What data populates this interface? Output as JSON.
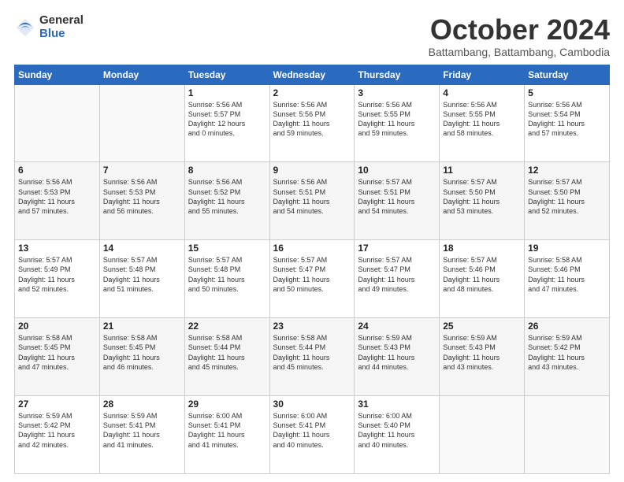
{
  "logo": {
    "general": "General",
    "blue": "Blue"
  },
  "header": {
    "month": "October 2024",
    "location": "Battambang, Battambang, Cambodia"
  },
  "days_of_week": [
    "Sunday",
    "Monday",
    "Tuesday",
    "Wednesday",
    "Thursday",
    "Friday",
    "Saturday"
  ],
  "weeks": [
    [
      {
        "day": "",
        "info": ""
      },
      {
        "day": "",
        "info": ""
      },
      {
        "day": "1",
        "info": "Sunrise: 5:56 AM\nSunset: 5:57 PM\nDaylight: 12 hours\nand 0 minutes."
      },
      {
        "day": "2",
        "info": "Sunrise: 5:56 AM\nSunset: 5:56 PM\nDaylight: 11 hours\nand 59 minutes."
      },
      {
        "day": "3",
        "info": "Sunrise: 5:56 AM\nSunset: 5:55 PM\nDaylight: 11 hours\nand 59 minutes."
      },
      {
        "day": "4",
        "info": "Sunrise: 5:56 AM\nSunset: 5:55 PM\nDaylight: 11 hours\nand 58 minutes."
      },
      {
        "day": "5",
        "info": "Sunrise: 5:56 AM\nSunset: 5:54 PM\nDaylight: 11 hours\nand 57 minutes."
      }
    ],
    [
      {
        "day": "6",
        "info": "Sunrise: 5:56 AM\nSunset: 5:53 PM\nDaylight: 11 hours\nand 57 minutes."
      },
      {
        "day": "7",
        "info": "Sunrise: 5:56 AM\nSunset: 5:53 PM\nDaylight: 11 hours\nand 56 minutes."
      },
      {
        "day": "8",
        "info": "Sunrise: 5:56 AM\nSunset: 5:52 PM\nDaylight: 11 hours\nand 55 minutes."
      },
      {
        "day": "9",
        "info": "Sunrise: 5:56 AM\nSunset: 5:51 PM\nDaylight: 11 hours\nand 54 minutes."
      },
      {
        "day": "10",
        "info": "Sunrise: 5:57 AM\nSunset: 5:51 PM\nDaylight: 11 hours\nand 54 minutes."
      },
      {
        "day": "11",
        "info": "Sunrise: 5:57 AM\nSunset: 5:50 PM\nDaylight: 11 hours\nand 53 minutes."
      },
      {
        "day": "12",
        "info": "Sunrise: 5:57 AM\nSunset: 5:50 PM\nDaylight: 11 hours\nand 52 minutes."
      }
    ],
    [
      {
        "day": "13",
        "info": "Sunrise: 5:57 AM\nSunset: 5:49 PM\nDaylight: 11 hours\nand 52 minutes."
      },
      {
        "day": "14",
        "info": "Sunrise: 5:57 AM\nSunset: 5:48 PM\nDaylight: 11 hours\nand 51 minutes."
      },
      {
        "day": "15",
        "info": "Sunrise: 5:57 AM\nSunset: 5:48 PM\nDaylight: 11 hours\nand 50 minutes."
      },
      {
        "day": "16",
        "info": "Sunrise: 5:57 AM\nSunset: 5:47 PM\nDaylight: 11 hours\nand 50 minutes."
      },
      {
        "day": "17",
        "info": "Sunrise: 5:57 AM\nSunset: 5:47 PM\nDaylight: 11 hours\nand 49 minutes."
      },
      {
        "day": "18",
        "info": "Sunrise: 5:57 AM\nSunset: 5:46 PM\nDaylight: 11 hours\nand 48 minutes."
      },
      {
        "day": "19",
        "info": "Sunrise: 5:58 AM\nSunset: 5:46 PM\nDaylight: 11 hours\nand 47 minutes."
      }
    ],
    [
      {
        "day": "20",
        "info": "Sunrise: 5:58 AM\nSunset: 5:45 PM\nDaylight: 11 hours\nand 47 minutes."
      },
      {
        "day": "21",
        "info": "Sunrise: 5:58 AM\nSunset: 5:45 PM\nDaylight: 11 hours\nand 46 minutes."
      },
      {
        "day": "22",
        "info": "Sunrise: 5:58 AM\nSunset: 5:44 PM\nDaylight: 11 hours\nand 45 minutes."
      },
      {
        "day": "23",
        "info": "Sunrise: 5:58 AM\nSunset: 5:44 PM\nDaylight: 11 hours\nand 45 minutes."
      },
      {
        "day": "24",
        "info": "Sunrise: 5:59 AM\nSunset: 5:43 PM\nDaylight: 11 hours\nand 44 minutes."
      },
      {
        "day": "25",
        "info": "Sunrise: 5:59 AM\nSunset: 5:43 PM\nDaylight: 11 hours\nand 43 minutes."
      },
      {
        "day": "26",
        "info": "Sunrise: 5:59 AM\nSunset: 5:42 PM\nDaylight: 11 hours\nand 43 minutes."
      }
    ],
    [
      {
        "day": "27",
        "info": "Sunrise: 5:59 AM\nSunset: 5:42 PM\nDaylight: 11 hours\nand 42 minutes."
      },
      {
        "day": "28",
        "info": "Sunrise: 5:59 AM\nSunset: 5:41 PM\nDaylight: 11 hours\nand 41 minutes."
      },
      {
        "day": "29",
        "info": "Sunrise: 6:00 AM\nSunset: 5:41 PM\nDaylight: 11 hours\nand 41 minutes."
      },
      {
        "day": "30",
        "info": "Sunrise: 6:00 AM\nSunset: 5:41 PM\nDaylight: 11 hours\nand 40 minutes."
      },
      {
        "day": "31",
        "info": "Sunrise: 6:00 AM\nSunset: 5:40 PM\nDaylight: 11 hours\nand 40 minutes."
      },
      {
        "day": "",
        "info": ""
      },
      {
        "day": "",
        "info": ""
      }
    ]
  ]
}
